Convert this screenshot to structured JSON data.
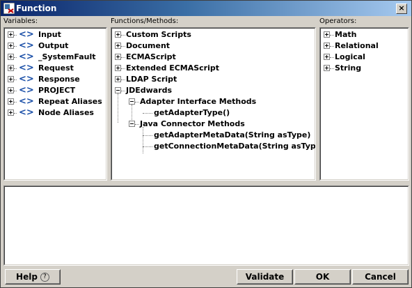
{
  "window": {
    "title": "Function",
    "close_glyph": "×"
  },
  "variables": {
    "label": "Variables:",
    "items": [
      "Input",
      "Output",
      "_SystemFault",
      "Request",
      "Response",
      "PROJECT",
      "Repeat Aliases",
      "Node Aliases"
    ],
    "icon": "angle-brackets-icon",
    "icon_glyph": "<>"
  },
  "functions": {
    "label": "Functions/Methods:",
    "items": [
      "Custom Scripts",
      "Document",
      "ECMAScript",
      "Extended ECMAScript",
      "LDAP Script"
    ],
    "jdedwards": {
      "label": "JDEdwards",
      "adapter": {
        "label": "Adapter Interface Methods",
        "children": [
          "getAdapterType()"
        ]
      },
      "connector": {
        "label": "Java Connector Methods",
        "children": [
          "getAdapterMetaData(String asType)",
          "getConnectionMetaData(String asType)"
        ]
      }
    }
  },
  "operators": {
    "label": "Operators:",
    "items": [
      "Math",
      "Relational",
      "Logical",
      "String"
    ]
  },
  "editor": {
    "value": ""
  },
  "buttons": {
    "help": "Help",
    "help_glyph": "?",
    "validate": "Validate",
    "ok": "OK",
    "cancel": "Cancel"
  },
  "colors": {
    "title_start": "#0a246a",
    "title_end": "#a6caf0",
    "icon_blue": "#1a4fa8",
    "face": "#d4d0c8"
  }
}
